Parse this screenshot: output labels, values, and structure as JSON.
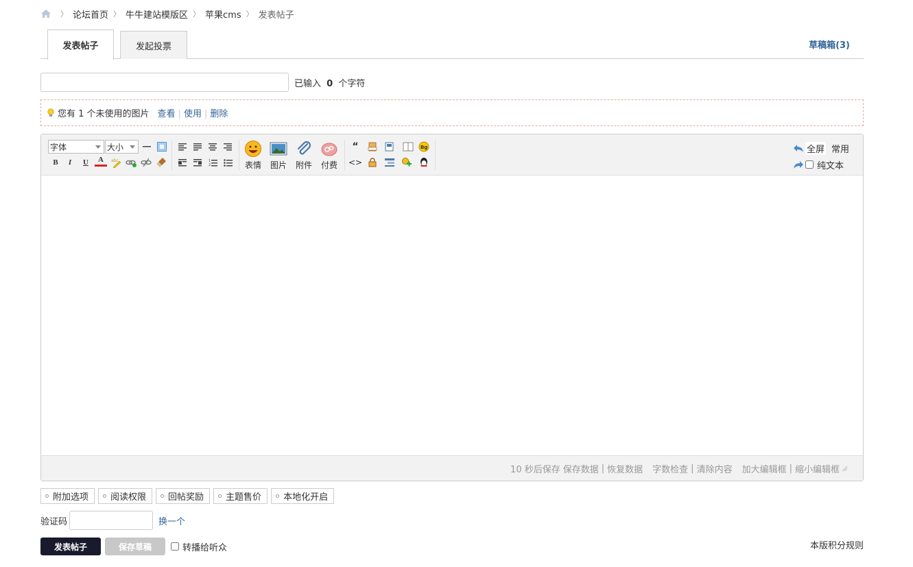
{
  "breadcrumb": {
    "items": [
      "论坛首页",
      "牛牛建站模版区",
      "苹果cms"
    ],
    "current": "发表帖子"
  },
  "tabs": {
    "post": "发表帖子",
    "poll": "发起投票",
    "drafts": "草稿箱(3)"
  },
  "subject": {
    "value": "",
    "count_prefix": "已输入",
    "count": "0",
    "count_suffix": "个字符"
  },
  "notice": {
    "text": "您有 1 个未使用的图片",
    "view": "查看",
    "use": "使用",
    "delete": "删除"
  },
  "toolbar": {
    "font": "字体",
    "size": "大小",
    "bold": "B",
    "italic": "I",
    "underline": "U",
    "font_color": "A",
    "emoticon": "表情",
    "image": "图片",
    "attachment": "附件",
    "paid": "付费",
    "fullscreen": "全屏",
    "common": "常用",
    "plain_text": "纯文本"
  },
  "editor_footer": {
    "autosave": "10 秒后保存",
    "save_data": "保存数据",
    "restore_data": "恢复数据",
    "word_check": "字数检查",
    "clear": "清除内容",
    "enlarge": "加大编辑框",
    "shrink": "缩小编辑框"
  },
  "options": [
    "附加选项",
    "阅读权限",
    "回帖奖励",
    "主题售价",
    "本地化开启"
  ],
  "captcha": {
    "label": "验证码",
    "refresh": "换一个"
  },
  "actions": {
    "submit": "发表帖子",
    "save_draft": "保存草稿",
    "broadcast": "转播给听众",
    "rules": "本版积分规则"
  },
  "colors": {
    "link": "#336699",
    "primary_button": "#1a1a2e",
    "notice_border": "#e8a8a8"
  }
}
